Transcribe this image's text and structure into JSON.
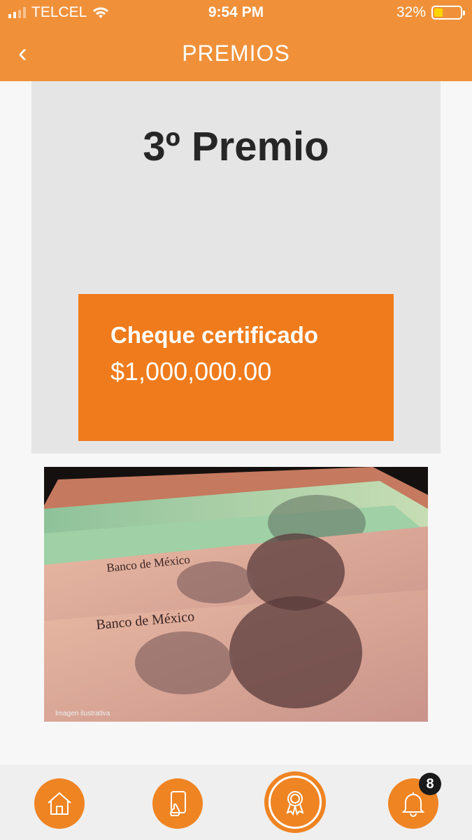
{
  "status_bar": {
    "carrier": "TELCEL",
    "time": "9:54 PM",
    "battery_percent": "32%",
    "battery_level": 0.32
  },
  "nav": {
    "back_label": "‹",
    "title": "PREMIOS"
  },
  "prize": {
    "title": "3º Premio",
    "name": "Cheque certificado",
    "amount": "$1,000,000.00"
  },
  "photo": {
    "caption": "Imagen ilustrativa",
    "note_text_1": "Banco de México",
    "note_text_2": "Banco de México"
  },
  "tabs": [
    {
      "icon": "home-icon"
    },
    {
      "icon": "phone-tap-icon"
    },
    {
      "icon": "award-icon",
      "active": true
    },
    {
      "icon": "bell-icon",
      "badge": "8"
    }
  ],
  "colors": {
    "brand_orange": "#f0913a",
    "prize_box": "#ef7b1c",
    "card_bg": "#e5e5e5"
  }
}
